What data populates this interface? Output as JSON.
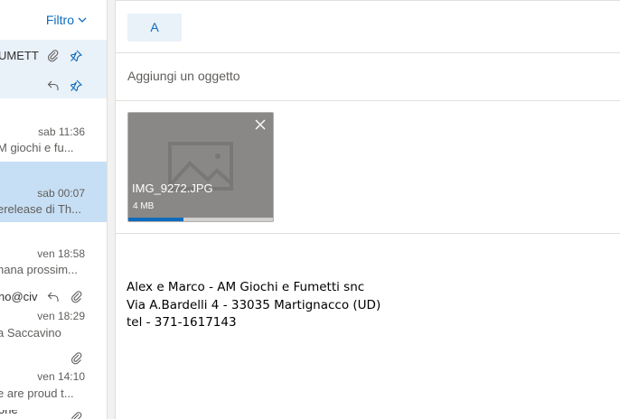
{
  "filter": {
    "label": "Filtro"
  },
  "messages": [
    {
      "sender": "UMETT"
    },
    {
      "time": "sab 11:36",
      "preview": "M giochi e fu..."
    },
    {
      "time": "sab 00:07",
      "preview": "erelease di Th..."
    },
    {
      "time": "ven 18:58",
      "preview": "nana prossim..."
    },
    {
      "sender": "no@civ",
      "time": "ven 18:29",
      "preview": "a Saccavino"
    },
    {
      "time": "ven 14:10",
      "preview": "e are proud t..."
    },
    {
      "sender": "one"
    }
  ],
  "compose": {
    "to_label": "A",
    "subject_placeholder": "Aggiungi un oggetto",
    "attachment": {
      "name": "IMG_9272.JPG",
      "size": "4 MB",
      "upload_progress": 0.38
    },
    "signature": [
      "Alex e Marco - AM Giochi e Fumetti snc",
      "Via A.Bardelli 4 - 33035 Martignacco (UD)",
      "tel - 371-1617143"
    ]
  },
  "colors": {
    "accent": "#0f6cbd",
    "pinned_bg": "#e9f1f9",
    "selected_bg": "#c7dff4"
  }
}
